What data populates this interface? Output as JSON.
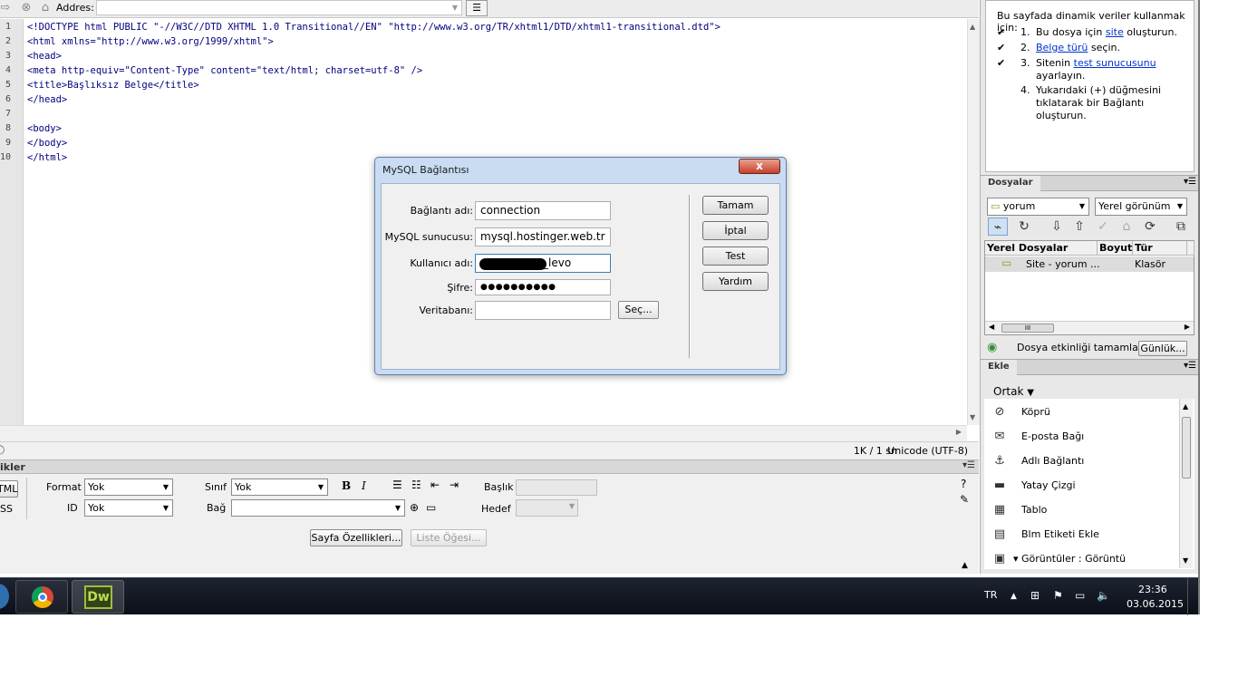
{
  "address_bar": {
    "label": "Addres:",
    "value": ""
  },
  "code_lines": [
    "<!DOCTYPE html PUBLIC \"-//W3C//DTD XHTML 1.0 Transitional//EN\" \"http://www.w3.org/TR/xhtml1/DTD/xhtml1-transitional.dtd\">",
    "<html xmlns=\"http://www.w3.org/1999/xhtml\">",
    "<head>",
    "<meta http-equiv=\"Content-Type\" content=\"text/html; charset=utf-8\" />",
    "<title>Başlıksız Belge</title>",
    "</head>",
    "",
    "<body>",
    "</body>",
    "</html>"
  ],
  "line_numbers": [
    "1",
    "2",
    "3",
    "4",
    "5",
    "6",
    "7",
    "8",
    "9",
    "10"
  ],
  "status": {
    "size": "1K / 1 sn",
    "encoding": "Unicode (UTF-8)"
  },
  "properties": {
    "title": "ikler",
    "html_btn": "TML",
    "css_btn": "SS",
    "format_label": "Format",
    "format_value": "Yok",
    "id_label": "ID",
    "id_value": "Yok",
    "class_label": "Sınıf",
    "class_value": "Yok",
    "link_label": "Bağ",
    "link_value": "",
    "bold": "B",
    "italic": "I",
    "title_label": "Başlık",
    "target_label": "Hedef",
    "page_props_btn": "Sayfa Özellikleri...",
    "list_item_btn": "Liste Öğesi..."
  },
  "dialog": {
    "title": "MySQL Bağlantısı",
    "close": "x",
    "fields": {
      "conn_name_label": "Bağlantı adı:",
      "conn_name_value": "connection",
      "server_label": "MySQL sunucusu:",
      "server_value": "mysql.hostinger.web.tr",
      "user_label": "Kullanıcı adı:",
      "user_value": "_levo",
      "pass_label": "Şifre:",
      "pass_value": "●●●●●●●●●●",
      "db_label": "Veritabanı:",
      "db_value": ""
    },
    "select_btn": "Seç...",
    "buttons": {
      "ok": "Tamam",
      "cancel": "İptal",
      "test": "Test",
      "help": "Yardım"
    }
  },
  "help_panel": {
    "intro": "Bu sayfada dinamik veriler kullanmak için:",
    "steps": [
      {
        "check": "✔",
        "num": "1.",
        "pre": "Bu dosya için ",
        "link": "site",
        "post": " oluşturun."
      },
      {
        "check": "✔",
        "num": "2.",
        "pre": "",
        "link": "Belge türü",
        "post": " seçin."
      },
      {
        "check": "✔",
        "num": "3.",
        "pre": "Sitenin ",
        "link": "test sunucusunu",
        "post": " ayarlayın."
      },
      {
        "check": "",
        "num": "4.",
        "pre": "Yukarıdaki (+) düğmesini tıklatarak bir Bağlantı oluşturun.",
        "link": "",
        "post": ""
      }
    ]
  },
  "files_panel": {
    "tab": "Dosyalar",
    "site_select": "yorum",
    "view_select": "Yerel görünüm",
    "columns": [
      "Yerel Dosyalar",
      "Boyut",
      "Tür",
      ""
    ],
    "row": {
      "name": "Site - yorum ...",
      "size": "",
      "type": "Klasör"
    },
    "scroll_grip": "III",
    "status": "Dosya etkinliği tamamlar",
    "log_btn": "Günlük..."
  },
  "insert_panel": {
    "tab": "Ekle",
    "category": "Ortak",
    "items": [
      "Köprü",
      "E-posta Bağı",
      "Adlı Bağlantı",
      "Yatay Çizgi",
      "Tablo",
      "Blm Etiketi Ekle",
      "Görüntüler : Görüntü"
    ]
  },
  "taskbar": {
    "lang": "TR",
    "time": "23:36",
    "date": "03.06.2015",
    "dw_label": "Dw"
  }
}
